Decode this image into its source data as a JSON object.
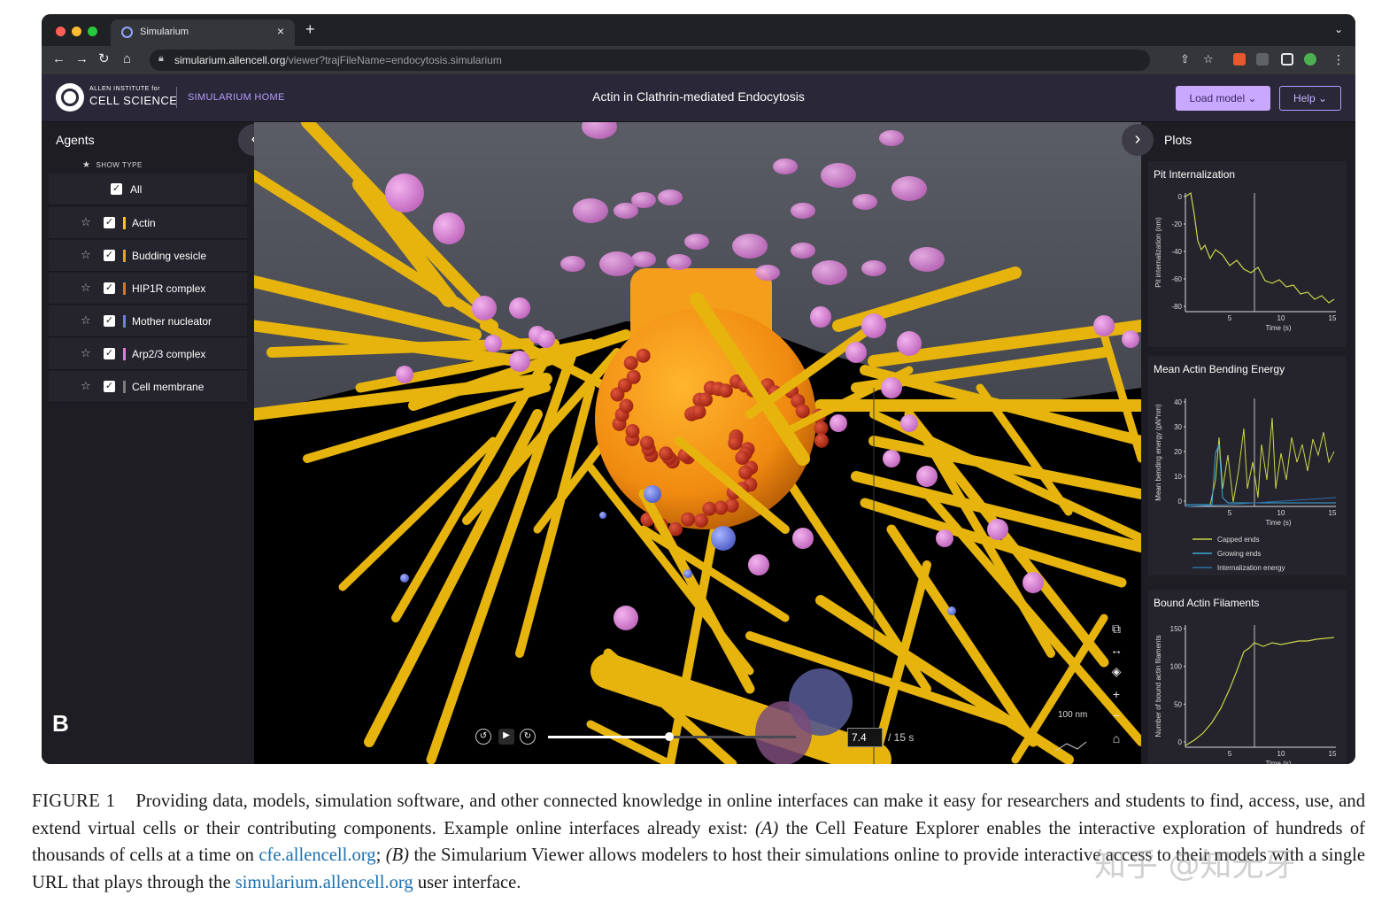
{
  "browser": {
    "tab_title": "Simularium",
    "tab_close": "×",
    "new_tab": "+",
    "url_host": "simularium.allencell.org",
    "url_path": "/viewer?trajFileName=endocytosis.simularium",
    "nav_icons": [
      "back-icon",
      "forward-icon",
      "reload-icon",
      "home-icon",
      "lock-icon"
    ],
    "traffic_light_colors": [
      "#ff5f57",
      "#febc2e",
      "#28c840"
    ]
  },
  "header": {
    "org_small": "ALLEN INSTITUTE for",
    "org_big": "CELL SCIENCE",
    "home_link": "SIMULARIUM HOME",
    "title": "Actin in Clathrin-mediated Endocytosis",
    "load_model": "Load model ⌄",
    "help": "Help ⌄",
    "accent": "#c9a8ff"
  },
  "agents": {
    "title": "Agents",
    "show_type": "SHOW TYPE",
    "all_label": "All",
    "items": [
      {
        "label": "Actin",
        "color": "#f5c518"
      },
      {
        "label": "Budding vesicle",
        "color": "#f39c1f"
      },
      {
        "label": "HIP1R complex",
        "color": "#e0731a"
      },
      {
        "label": "Mother nucleator",
        "color": "#6f7fe0"
      },
      {
        "label": "Arp2/3 complex",
        "color": "#e07ad8"
      },
      {
        "label": "Cell membrane",
        "color": "#7b7b7b"
      }
    ],
    "collapse_glyph": "‹",
    "panel_letter": "B"
  },
  "viewer": {
    "current_time": "7.4",
    "total_time": "/ 15 s",
    "progress_fraction": 0.49,
    "scale_label": "100 nm",
    "buttons": [
      "step-back-icon",
      "play-icon",
      "step-forward-icon"
    ]
  },
  "plots": {
    "title": "Plots",
    "expand_glyph": "›",
    "cards": [
      {
        "title": "Pit Internalization",
        "ylabel": "Pit internalization (nm)",
        "xlabel": "Time (s)",
        "yticks": [
          "0",
          "-20",
          "-40",
          "-60",
          "-80"
        ],
        "xticks": [
          "5",
          "10",
          "15"
        ]
      },
      {
        "title": "Mean Actin Bending Energy",
        "ylabel": "Mean bending energy (pN*nm)",
        "xlabel": "Time (s)",
        "yticks": [
          "40",
          "30",
          "20",
          "10",
          "0"
        ],
        "xticks": [
          "5",
          "10",
          "15"
        ],
        "legend": [
          "Capped ends",
          "Growing ends",
          "Internalization energy"
        ],
        "legend_colors": [
          "#c9d64a",
          "#3aa7d8",
          "#2e6fa8"
        ]
      },
      {
        "title": "Bound Actin Filaments",
        "ylabel": "Number of bound actin filaments",
        "xlabel": "Time (s)",
        "yticks": [
          "150",
          "100",
          "50",
          "0"
        ],
        "xticks": [
          "5",
          "10",
          "15"
        ]
      }
    ]
  },
  "caption": {
    "figure_label": "FIGURE 1",
    "part1": "Providing data, models, simulation software, and other connected knowledge in online interfaces can make it easy for researchers and students to find, access, use, and extend virtual cells or their contributing components. Example online interfaces already exist: ",
    "a_label": "(A)",
    "part2": " the Cell Feature Explorer enables the interactive exploration of hundreds of thousands of cells at a time on ",
    "link1": "cfe.allencell.org",
    "part3": "; ",
    "b_label": "(B)",
    "part4": " the Simularium Viewer allows modelers to host their simulations online to provide interactive access to their models with a single URL that plays through the ",
    "link2": "simularium.allencell.org",
    "part5": " user interface."
  },
  "watermark": "知乎 @知无牙"
}
